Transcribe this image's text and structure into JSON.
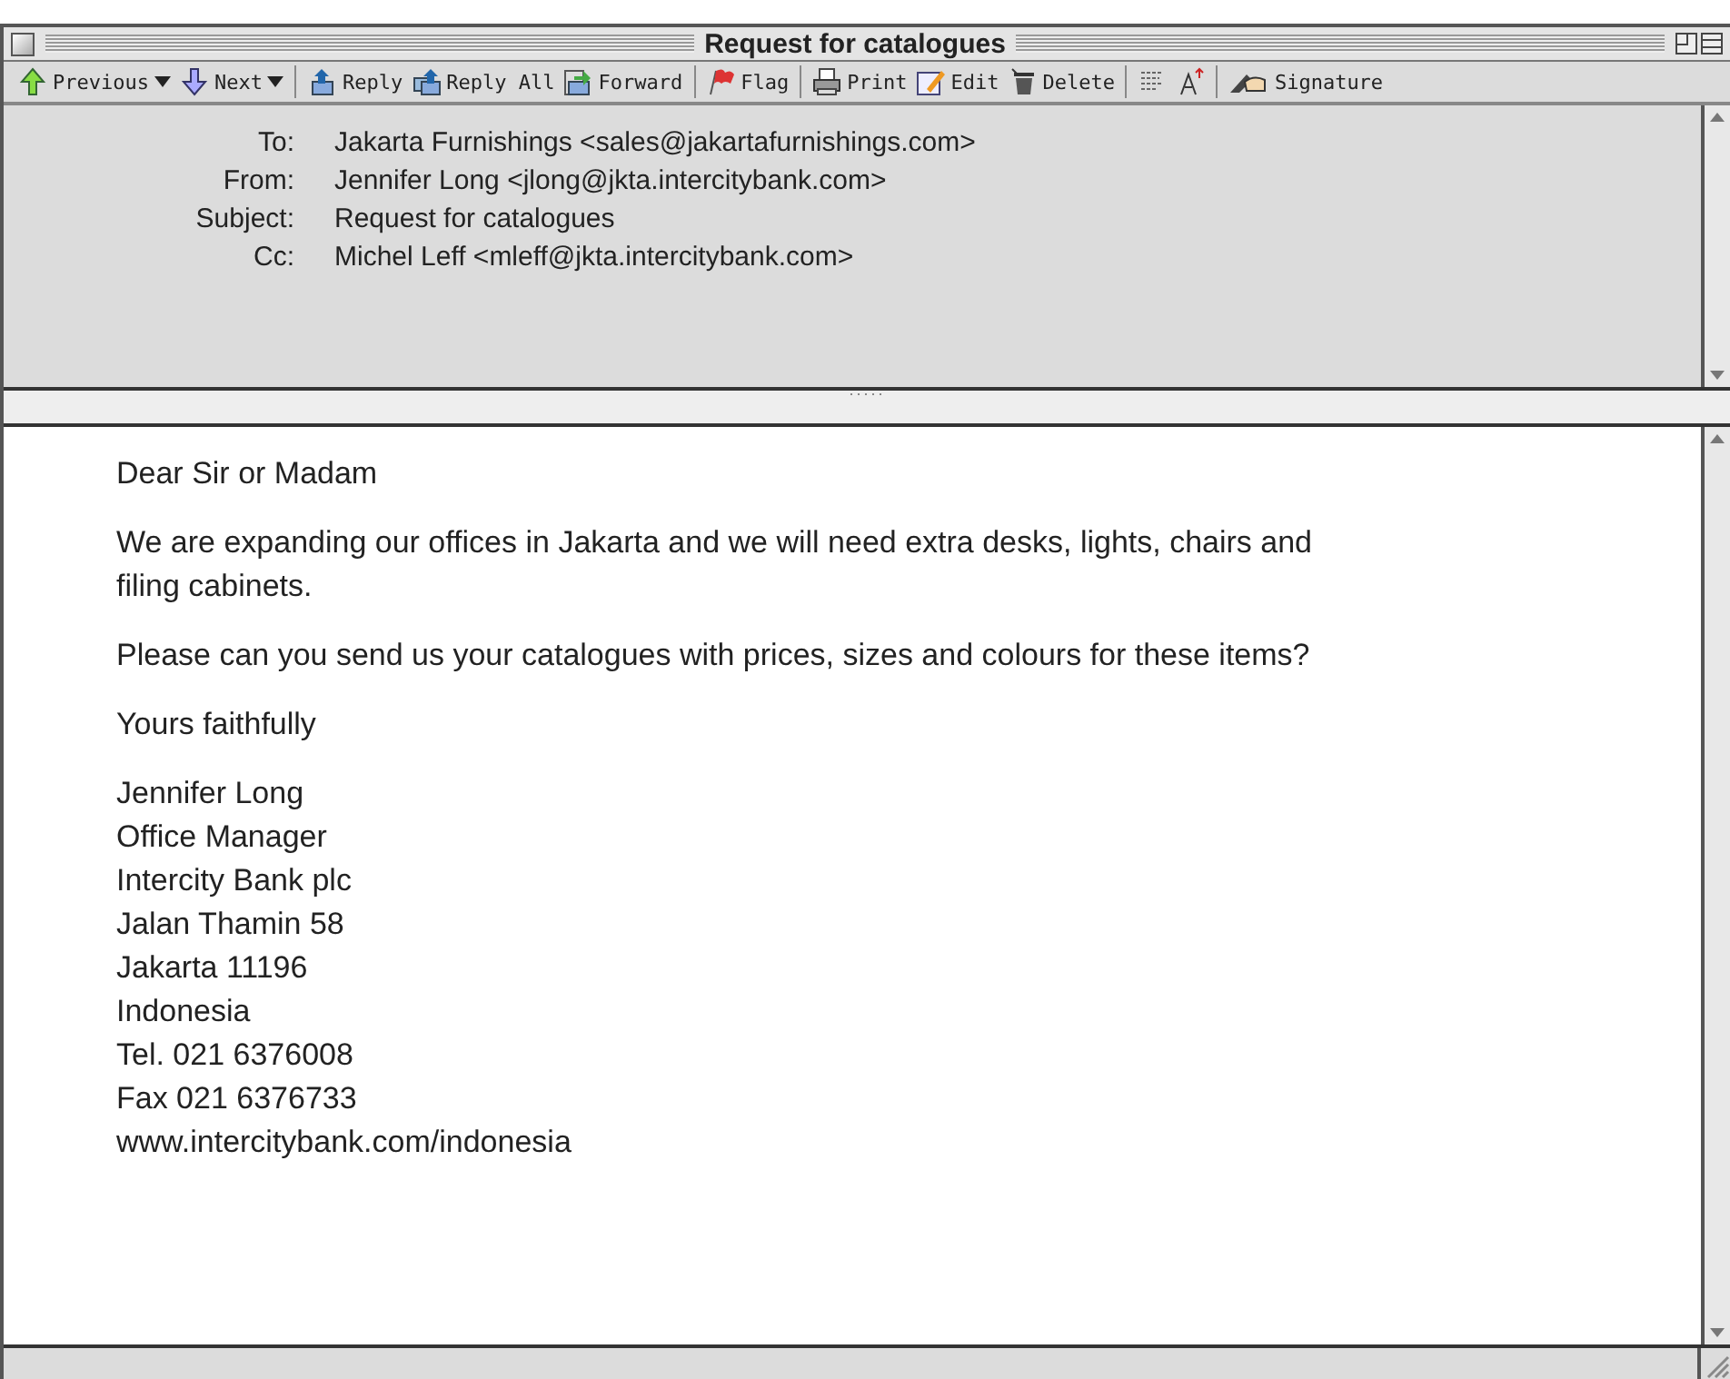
{
  "window": {
    "title": "Request for catalogues"
  },
  "toolbar": [
    [
      {
        "label": "Previous",
        "dropdown": true
      },
      {
        "label": "Next",
        "dropdown": true
      }
    ],
    [
      {
        "label": "Reply",
        "dropdown": false
      },
      {
        "label": "Reply All",
        "dropdown": false
      },
      {
        "label": "Forward",
        "dropdown": false
      }
    ],
    [
      {
        "label": "Flag",
        "dropdown": false
      }
    ],
    [
      {
        "label": "Print",
        "dropdown": false
      },
      {
        "label": "Edit",
        "dropdown": false
      },
      {
        "label": "Delete",
        "dropdown": false
      }
    ],
    [
      {
        "dropdown": false
      },
      {
        "dropdown": false
      }
    ],
    [
      {
        "label": "Signature",
        "dropdown": false
      }
    ]
  ],
  "header": [
    {
      "label": "To:",
      "value": "Jakarta Furnishings <sales@jakartafurnishings.com>"
    },
    {
      "label": "From:",
      "value": "Jennifer Long <jlong@jkta.intercitybank.com>"
    },
    {
      "label": "Subject:",
      "value": "Request for catalogues"
    },
    {
      "label": "Cc:",
      "value": "Michel Leff <mleff@jkta.intercitybank.com>"
    }
  ],
  "body": {
    "paragraphs": [
      "Dear Sir or Madam",
      "We are expanding our offices in Jakarta and we will need extra desks, lights, chairs and filing cabinets.",
      "Please can you send us your catalogues with prices, sizes and colours for these items?",
      "Yours faithfully"
    ],
    "signature": [
      "Jennifer Long",
      "Office Manager",
      "Intercity Bank plc",
      "Jalan Thamin 58",
      "Jakarta 11196",
      "Indonesia",
      "Tel. 021 6376008",
      "Fax 021 6376733",
      "www.intercitybank.com/indonesia"
    ]
  }
}
